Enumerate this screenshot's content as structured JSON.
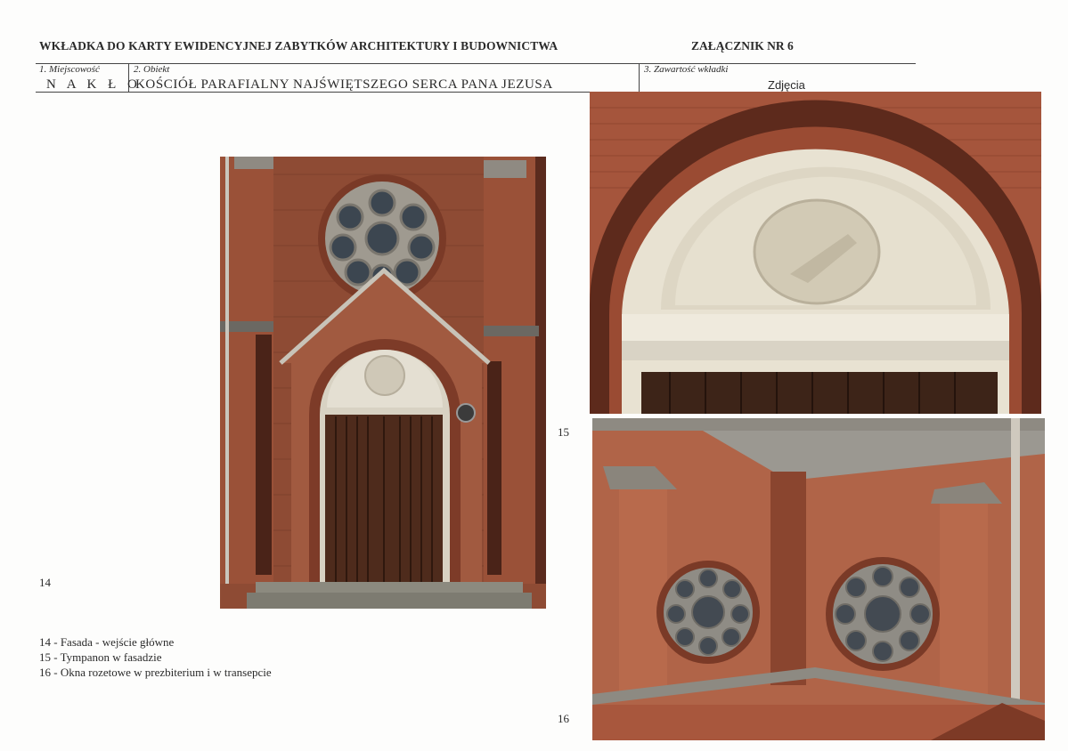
{
  "header": {
    "title": "WKŁADKA DO KARTY EWIDENCYJNEJ ZABYTKÓW ARCHITEKTURY I BUDOWNICTWA",
    "annex": "ZAŁĄCZNIK NR 6"
  },
  "fields": {
    "place": {
      "label": "1. Miejscowość",
      "value": "N A K Ł O"
    },
    "object": {
      "label": "2. Obiekt",
      "value": "KOŚCIÓŁ PARAFIALNY NAJŚWIĘTSZEGO SERCA PANA JEZUSA"
    },
    "content": {
      "label": "3. Zawartość wkładki",
      "value": "Zdjęcia"
    }
  },
  "photos": [
    {
      "number": "14"
    },
    {
      "number": "15"
    },
    {
      "number": "16"
    }
  ],
  "captions": [
    "14 - Fasada - wejście główne",
    "15 - Tympanon w fasadzie",
    "16 - Okna rozetowe w prezbiterium i w transepcie"
  ]
}
